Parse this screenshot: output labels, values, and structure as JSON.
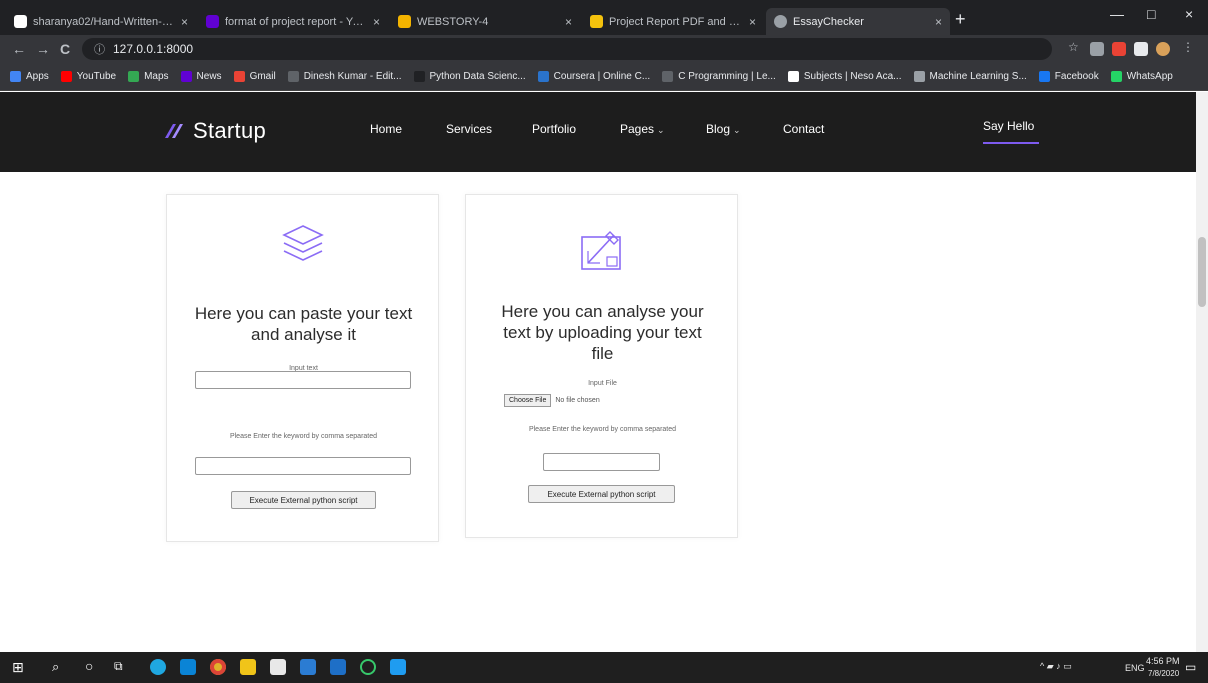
{
  "browser": {
    "tabs": [
      {
        "title": "sharanya02/Hand-Written-digit-",
        "favicon_color": "#ffffff",
        "active": false
      },
      {
        "title": "format of project report - Yahoo",
        "favicon_color": "#6001d2",
        "active": false
      },
      {
        "title": "WEBSTORY-4",
        "favicon_color": "#f4b400",
        "active": false
      },
      {
        "title": "Project Report PDF and Excel - ",
        "favicon_color": "#f4c20d",
        "active": false
      },
      {
        "title": "EssayChecker",
        "favicon_color": "#9aa0a6",
        "active": true
      }
    ],
    "tab_close_glyph": "×",
    "new_tab_glyph": "+",
    "window_controls": {
      "minimize": "—",
      "maximize": "□",
      "close": "×"
    },
    "back_glyph": "←",
    "forward_glyph": "→",
    "reload_glyph": "C",
    "info_glyph": "ⓘ",
    "address": "127.0.0.1:8000"
  },
  "bookmarks": [
    {
      "label": "Apps",
      "color": "#4285f4"
    },
    {
      "label": "YouTube",
      "color": "#ff0000"
    },
    {
      "label": "Maps",
      "color": "#34a853"
    },
    {
      "label": "News",
      "color": "#6001d2"
    },
    {
      "label": "Gmail",
      "color": "#ea4335"
    },
    {
      "label": "Dinesh Kumar - Edit...",
      "color": "#5f6368"
    },
    {
      "label": "Python Data Scienc...",
      "color": "#202124"
    },
    {
      "label": "Coursera | Online C...",
      "color": "#2a73cc"
    },
    {
      "label": "C Programming | Le...",
      "color": "#5f6368"
    },
    {
      "label": "Subjects | Neso Aca...",
      "color": "#ffffff"
    },
    {
      "label": "Machine Learning S...",
      "color": "#9aa0a6"
    },
    {
      "label": "Facebook",
      "color": "#1877f2"
    },
    {
      "label": "WhatsApp",
      "color": "#25d366"
    }
  ],
  "site": {
    "brand": "Startup",
    "nav": [
      "Home",
      "Services",
      "Portfolio",
      "Pages",
      "Blog",
      "Contact"
    ],
    "nav_dropdown_glyph": "⌄",
    "cta": "Say Hello",
    "accent_color": "#7e5bef"
  },
  "cards": {
    "paste": {
      "heading": "Here you can paste your text and analyse it",
      "input_label": "Input text",
      "keywords_label": "Please Enter the keyword by comma separated",
      "button": "Execute External python script"
    },
    "upload": {
      "heading": "Here you can analyse your text by uploading your text file",
      "input_label": "Input File",
      "choose_button": "Choose File",
      "no_file": "No file chosen",
      "keywords_label": "Please Enter the keyword by comma separated",
      "button": "Execute External python script"
    }
  },
  "taskbar": {
    "time": "4:56 PM",
    "date": "7/8/2020",
    "lang": "ENG"
  }
}
